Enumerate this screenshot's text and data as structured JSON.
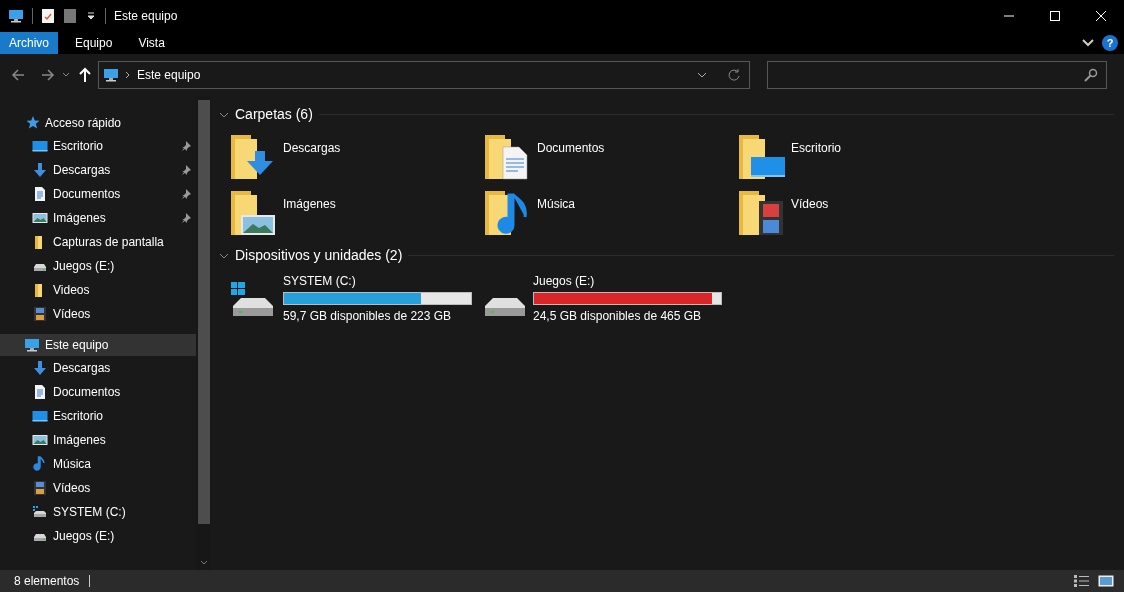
{
  "window": {
    "title": "Este equipo"
  },
  "ribbon_tabs": [
    {
      "label": "Archivo",
      "selected": true
    },
    {
      "label": "Equipo",
      "selected": false
    },
    {
      "label": "Vista",
      "selected": false
    }
  ],
  "help": "?",
  "address": {
    "path": "Este equipo"
  },
  "sidebar": {
    "sections": [
      {
        "label": "Acceso rápido",
        "kind": "star",
        "selected": false,
        "children": [
          {
            "label": "Escritorio",
            "kind": "desktop",
            "pinned": true
          },
          {
            "label": "Descargas",
            "kind": "download",
            "pinned": true
          },
          {
            "label": "Documentos",
            "kind": "document",
            "pinned": true
          },
          {
            "label": "Imágenes",
            "kind": "image",
            "pinned": true
          },
          {
            "label": "Capturas de pantalla",
            "kind": "folder",
            "pinned": false
          },
          {
            "label": "Juegos (E:)",
            "kind": "drive",
            "pinned": false
          },
          {
            "label": "Videos",
            "kind": "folder",
            "pinned": false
          },
          {
            "label": "Vídeos",
            "kind": "video",
            "pinned": false
          }
        ]
      },
      {
        "label": "Este equipo",
        "kind": "pc",
        "selected": true,
        "children": [
          {
            "label": "Descargas",
            "kind": "download",
            "pinned": false
          },
          {
            "label": "Documentos",
            "kind": "document",
            "pinned": false
          },
          {
            "label": "Escritorio",
            "kind": "desktop",
            "pinned": false
          },
          {
            "label": "Imágenes",
            "kind": "image",
            "pinned": false
          },
          {
            "label": "Música",
            "kind": "music",
            "pinned": false
          },
          {
            "label": "Vídeos",
            "kind": "video",
            "pinned": false
          },
          {
            "label": "SYSTEM (C:)",
            "kind": "sysdrive",
            "pinned": false
          },
          {
            "label": "Juegos (E:)",
            "kind": "drive",
            "pinned": false
          }
        ]
      }
    ]
  },
  "folders": {
    "heading": "Carpetas (6)",
    "items": [
      {
        "label": "Descargas",
        "kind": "download"
      },
      {
        "label": "Documentos",
        "kind": "document"
      },
      {
        "label": "Escritorio",
        "kind": "desktop"
      },
      {
        "label": "Imágenes",
        "kind": "image"
      },
      {
        "label": "Música",
        "kind": "music"
      },
      {
        "label": "Vídeos",
        "kind": "video"
      }
    ]
  },
  "drives": {
    "heading": "Dispositivos y unidades (2)",
    "items": [
      {
        "label": "SYSTEM (C:)",
        "kind": "sysdrive",
        "level": 0.73,
        "color": "#26a0da",
        "free": "59,7 GB disponibles de 223 GB"
      },
      {
        "label": "Juegos (E:)",
        "kind": "drive",
        "level": 0.95,
        "color": "#da2626",
        "free": "24,5 GB disponibles de 465 GB"
      }
    ]
  },
  "status_bar": {
    "count": "8 elementos"
  }
}
